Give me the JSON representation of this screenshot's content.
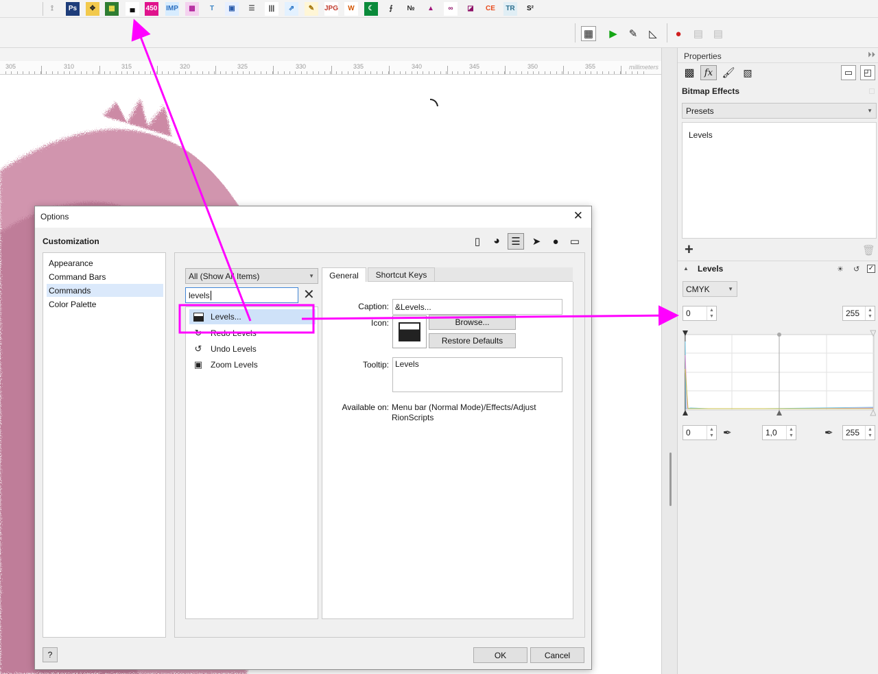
{
  "top_toolbar": {
    "icons": [
      {
        "name": "connector-tool-icon",
        "glyph": "⟟",
        "bg": "transparent",
        "fg": "#999"
      },
      {
        "name": "photoshop-icon",
        "glyph": "Ps",
        "bg": "#1e3d7a",
        "fg": "#ffffff"
      },
      {
        "name": "move-arrows-icon",
        "glyph": "✥",
        "bg": "#f2c94c",
        "fg": "#222"
      },
      {
        "name": "grid-four-icon",
        "glyph": "▦",
        "bg": "#2e7d32",
        "fg": "#f5e050"
      },
      {
        "name": "levels-icon",
        "glyph": "▄",
        "bg": "#ffffff",
        "fg": "#111"
      },
      {
        "name": "number-450-icon",
        "glyph": "450",
        "bg": "#e0138c",
        "fg": "#ffffff"
      },
      {
        "name": "imp-icon",
        "glyph": "IMP",
        "bg": "#d7ecff",
        "fg": "#2c6fbf"
      },
      {
        "name": "color-swatches-icon",
        "glyph": "▩",
        "bg": "#f4d2ef",
        "fg": "#b0209a"
      },
      {
        "name": "text-tool-icon",
        "glyph": "T",
        "bg": "transparent",
        "fg": "#3c84c4"
      },
      {
        "name": "qr-code-icon",
        "glyph": "▣",
        "bg": "#e8f0ff",
        "fg": "#2b5cab"
      },
      {
        "name": "stripes-icon",
        "glyph": "☰",
        "bg": "transparent",
        "fg": "#555"
      },
      {
        "name": "barcode-icon",
        "glyph": "|||",
        "bg": "#ffffff",
        "fg": "#222"
      },
      {
        "name": "export-icon",
        "glyph": "⇗",
        "bg": "#e3f1ff",
        "fg": "#1b6bc2"
      },
      {
        "name": "edit-document-icon",
        "glyph": "✎",
        "bg": "#fff6d6",
        "fg": "#a07000"
      },
      {
        "name": "jpg-pdf-icon",
        "glyph": "JPG",
        "bg": "#fff",
        "fg": "#c0392b"
      },
      {
        "name": "word-icon",
        "glyph": "W",
        "bg": "#ffffff",
        "fg": "#d35400"
      },
      {
        "name": "flag-icon",
        "glyph": "☾",
        "bg": "#0a8a3a",
        "fg": "#ffffff"
      },
      {
        "name": "curve-tool-icon",
        "glyph": "⨍",
        "bg": "transparent",
        "fg": "#222"
      },
      {
        "name": "numero-icon",
        "glyph": "№",
        "bg": "transparent",
        "fg": "#222"
      },
      {
        "name": "shape-trapezoid-icon",
        "glyph": "▲",
        "bg": "transparent",
        "fg": "#a0157a"
      },
      {
        "name": "infinity-icon",
        "glyph": "∞",
        "bg": "#ffffff",
        "fg": "#8e1168"
      },
      {
        "name": "folded-page-icon",
        "glyph": "◪",
        "bg": "transparent",
        "fg": "#8e1168"
      },
      {
        "name": "ce-mark-icon",
        "glyph": "CE",
        "bg": "transparent",
        "fg": "#e84a1b"
      },
      {
        "name": "tr-icon",
        "glyph": "TR",
        "bg": "#e0eef5",
        "fg": "#2d6f8e"
      },
      {
        "name": "s-squared-icon",
        "glyph": "S²",
        "bg": "transparent",
        "fg": "#111"
      }
    ]
  },
  "second_toolbar": {
    "icons": [
      {
        "name": "calendar-icon",
        "glyph": "▦"
      },
      {
        "name": "play-icon",
        "glyph": "▶"
      },
      {
        "name": "edit-macro-icon",
        "glyph": "✎"
      },
      {
        "name": "measure-icon",
        "glyph": "◺"
      },
      {
        "name": "record-icon",
        "glyph": "●"
      },
      {
        "name": "save-macro-icon",
        "glyph": "▤"
      },
      {
        "name": "macro-settings-icon",
        "glyph": "▤"
      }
    ]
  },
  "ruler": {
    "numbers": [
      "305",
      "310",
      "315",
      "320",
      "325",
      "330",
      "335",
      "340",
      "345",
      "350",
      "355"
    ],
    "unit": "millimeters"
  },
  "properties": {
    "title": "Properties",
    "section_title": "Bitmap Effects",
    "presets_label": "Presets",
    "effects_list": [
      "Levels"
    ],
    "levels_header": "Levels",
    "mode": "CMYK",
    "input_low": "0",
    "input_high": "255",
    "output_low": "0",
    "gamma": "1,0",
    "output_high": "255"
  },
  "dialog": {
    "title": "Options",
    "section": "Customization",
    "categories": [
      "Appearance",
      "Command Bars",
      "Commands",
      "Color Palette"
    ],
    "selected_category": "Commands",
    "filter_value": "All (Show All Items)",
    "search_value": "levels",
    "commands": [
      {
        "label": "Levels...",
        "icon": "levels-icon"
      },
      {
        "label": "Redo Levels",
        "icon": "redo-icon"
      },
      {
        "label": "Undo Levels",
        "icon": "undo-icon"
      },
      {
        "label": "Zoom Levels",
        "icon": "zoom-levels-icon"
      }
    ],
    "tabs": [
      "General",
      "Shortcut Keys"
    ],
    "caption_label": "Caption:",
    "caption_value": "&Levels...",
    "icon_label": "Icon:",
    "browse_label": "Browse...",
    "restore_label": "Restore Defaults",
    "tooltip_label": "Tooltip:",
    "tooltip_value": "Levels",
    "available_label": "Available on:",
    "available_value_1": "Menu bar (Normal Mode)/Effects/Adjust",
    "available_value_2": "RionScripts",
    "help_label": "?",
    "ok_label": "OK",
    "cancel_label": "Cancel"
  },
  "colors": {
    "annotation": "#ff00ff",
    "selection": "#dbe9fb",
    "fur": "#cc8aa5"
  }
}
